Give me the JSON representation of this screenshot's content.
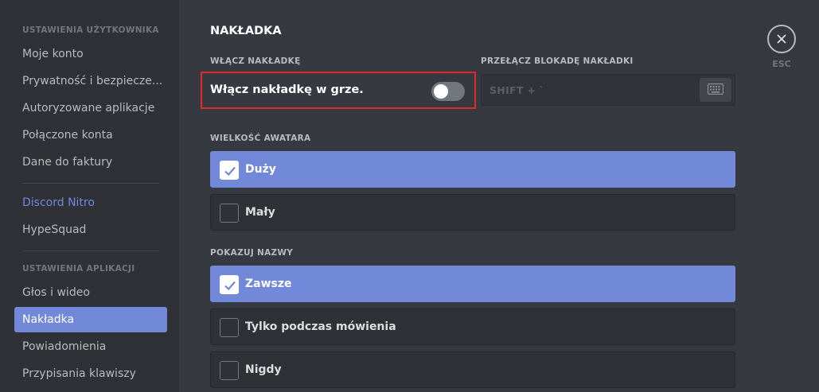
{
  "sidebar": {
    "user_settings_header": "USTAWIENIA UŻYTKOWNIKA",
    "user_items": [
      {
        "label": "Moje konto"
      },
      {
        "label": "Prywatność i bezpiecze..."
      },
      {
        "label": "Autoryzowane aplikacje"
      },
      {
        "label": "Połączone konta"
      },
      {
        "label": "Dane do faktury"
      }
    ],
    "nitro_label": "Discord Nitro",
    "hypesquad_label": "HypeSquad",
    "app_settings_header": "USTAWIENIA APLIKACJI",
    "app_items": [
      {
        "label": "Głos i wideo"
      },
      {
        "label": "Nakładka",
        "active": true
      },
      {
        "label": "Powiadomienia"
      },
      {
        "label": "Przypisania klawiszy"
      }
    ]
  },
  "main": {
    "title": "NAKŁADKA",
    "enable_overlay": {
      "section_label": "WŁĄCZ NAKŁADKĘ",
      "toggle_label": "Włącz nakładkę w grze.",
      "enabled": false
    },
    "lock_keybind": {
      "section_label": "PRZEŁĄCZ BLOKADĘ NAKŁADKI",
      "value": "SHIFT + `",
      "icon": "keyboard-icon"
    },
    "avatar_size": {
      "section_label": "WIELKOŚĆ AWATARA",
      "options": [
        {
          "label": "Duży",
          "selected": true
        },
        {
          "label": "Mały",
          "selected": false
        }
      ]
    },
    "show_names": {
      "section_label": "POKAZUJ NAZWY",
      "options": [
        {
          "label": "Zawsze",
          "selected": true
        },
        {
          "label": "Tylko podczas mówienia",
          "selected": false
        },
        {
          "label": "Nigdy",
          "selected": false
        }
      ]
    }
  },
  "close": {
    "icon": "close-icon",
    "label": "ESC"
  },
  "colors": {
    "accent": "#7289da",
    "background": "#36393f",
    "sidebar": "#2f3136",
    "highlight_border": "#e02b2b"
  }
}
